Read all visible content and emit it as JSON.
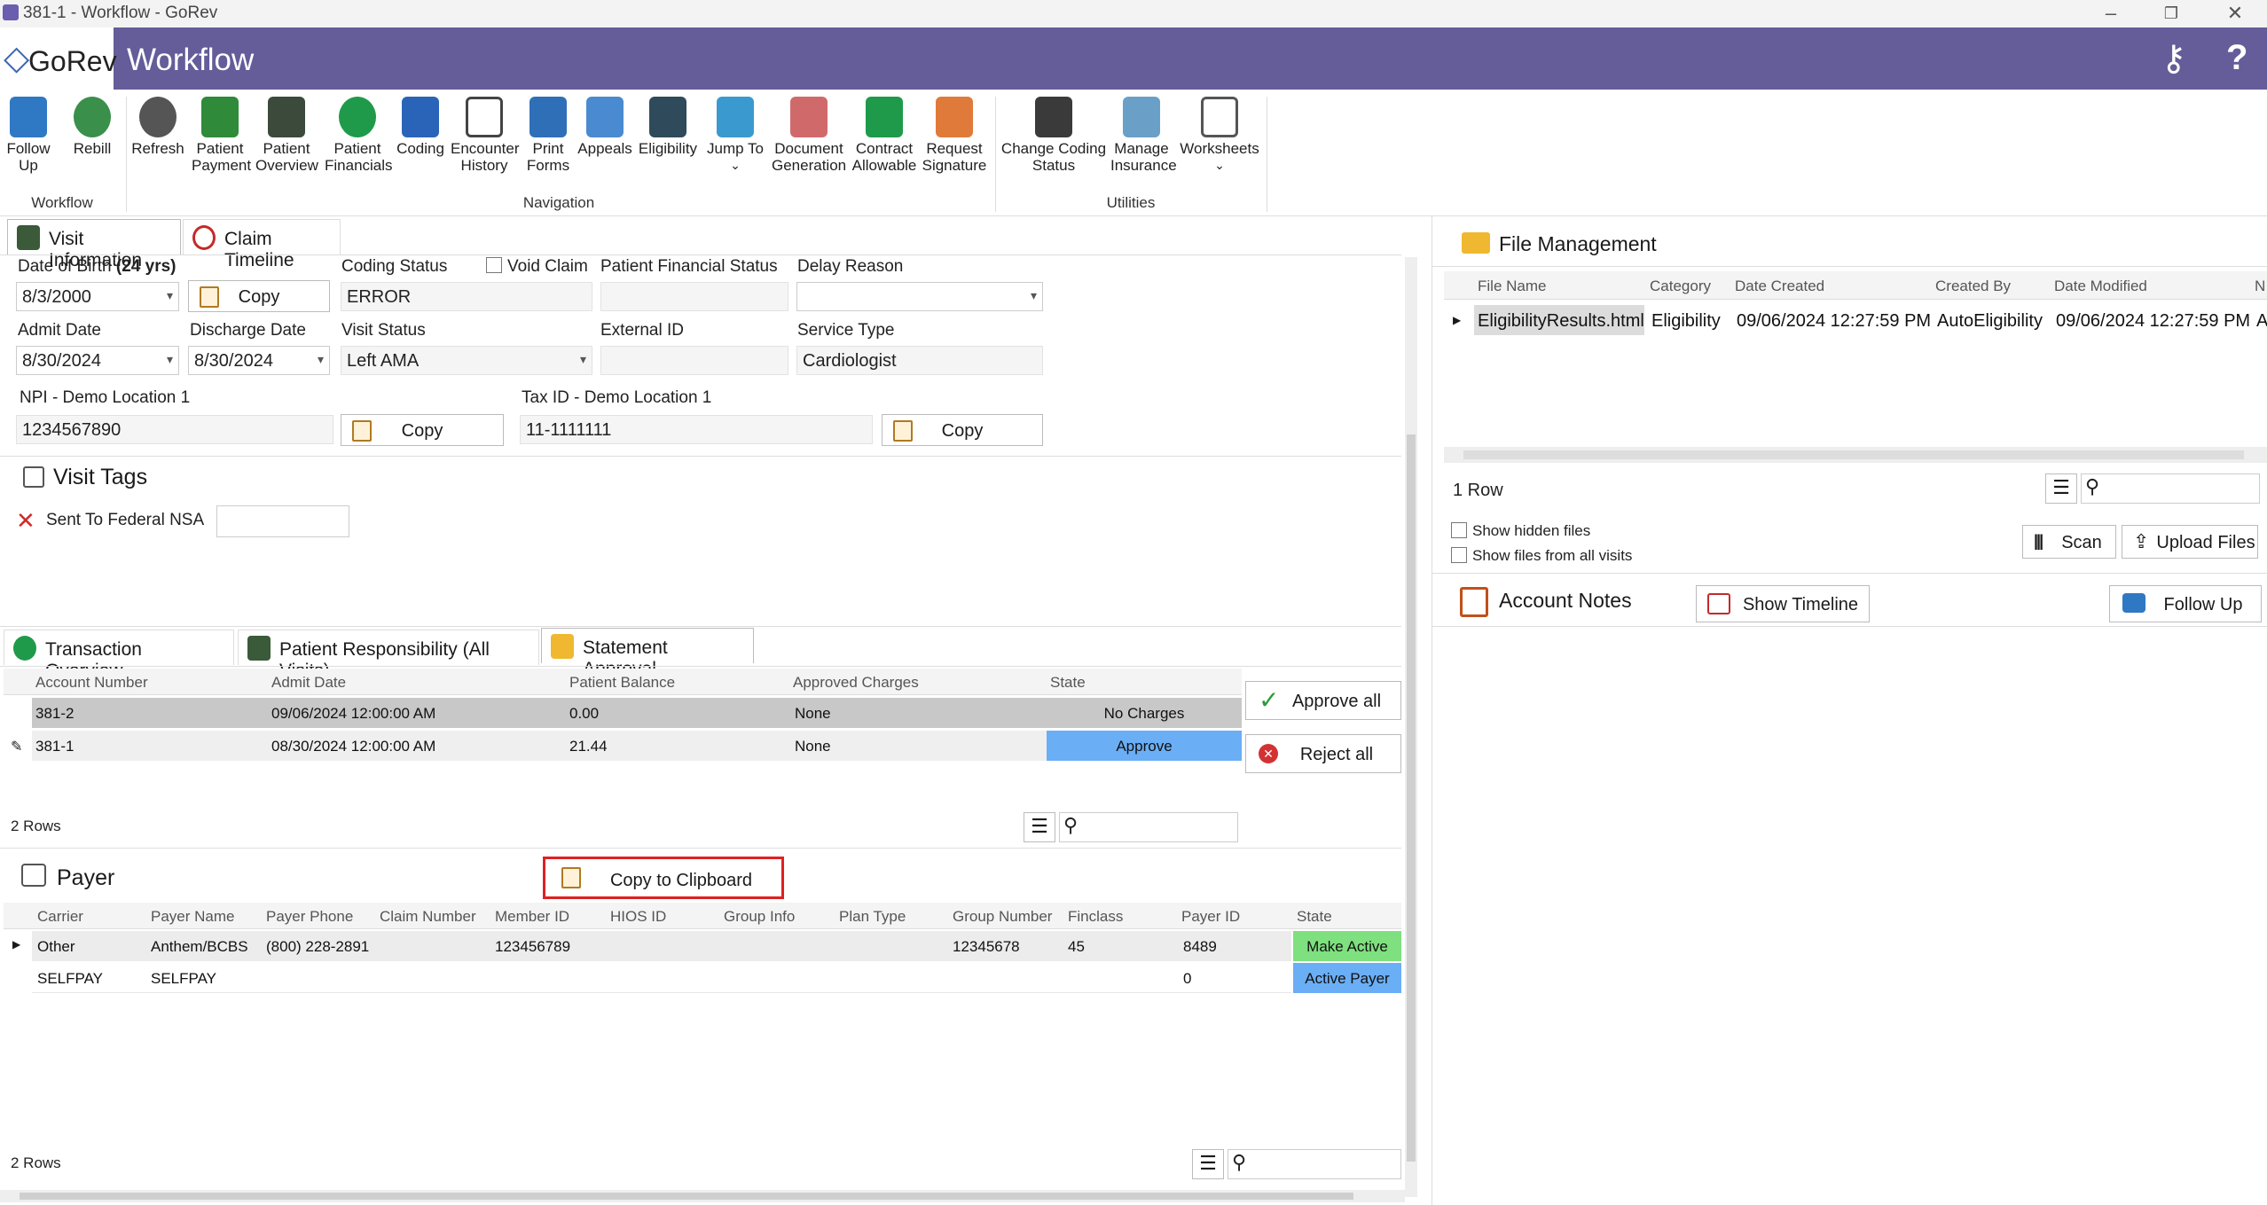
{
  "window": {
    "title": "381-1 - Workflow - GoRev"
  },
  "header": {
    "logo_text": "GoRev",
    "title": "Workflow"
  },
  "ribbon": {
    "items": [
      {
        "label": "Follow\nUp",
        "icon": "follow-up-icon"
      },
      {
        "label": "Rebill",
        "icon": "rebill-icon"
      },
      {
        "label": "Refresh",
        "icon": "refresh-icon"
      },
      {
        "label": "Patient\nPayment",
        "icon": "patient-payment-icon"
      },
      {
        "label": "Patient\nOverview",
        "icon": "patient-overview-icon"
      },
      {
        "label": "Patient\nFinancials",
        "icon": "dollar-icon"
      },
      {
        "label": "Coding",
        "icon": "coding-icon"
      },
      {
        "label": "Encounter\nHistory",
        "icon": "calendar-icon"
      },
      {
        "label": "Print\nForms",
        "icon": "printer-icon"
      },
      {
        "label": "Appeals",
        "icon": "appeals-icon"
      },
      {
        "label": "Eligibility",
        "icon": "eligibility-icon"
      },
      {
        "label": "Jump To",
        "icon": "jump-arrow-icon"
      },
      {
        "label": "Document\nGeneration",
        "icon": "document-generation-icon"
      },
      {
        "label": "Contract\nAllowable",
        "icon": "contract-icon"
      },
      {
        "label": "Request\nSignature",
        "icon": "signature-icon"
      },
      {
        "label": "Change Coding\nStatus",
        "icon": "change-status-icon"
      },
      {
        "label": "Manage\nInsurance",
        "icon": "insurance-icon"
      },
      {
        "label": "Worksheets",
        "icon": "worksheets-icon"
      }
    ],
    "groups": [
      "Workflow",
      "Navigation",
      "Utilities"
    ]
  },
  "visit_tabs": [
    "Visit Information",
    "Claim Timeline"
  ],
  "visit": {
    "dob_label": "Date of Birth",
    "dob_age": "(24 yrs)",
    "dob": "8/3/2000",
    "copy": "Copy",
    "coding_status_label": "Coding Status",
    "coding_status": "ERROR",
    "void_claim": "Void Claim",
    "pfs_label": "Patient Financial Status",
    "delay_label": "Delay Reason",
    "admit_label": "Admit Date",
    "admit": "8/30/2024",
    "discharge_label": "Discharge Date",
    "discharge": "8/30/2024",
    "visit_status_label": "Visit Status",
    "visit_status": "Left AMA",
    "external_id_label": "External ID",
    "service_type_label": "Service Type",
    "service_type": "Cardiologist",
    "npi_label": "NPI - Demo Location 1",
    "npi": "1234567890",
    "tax_label": "Tax ID - Demo Location 1",
    "tax": "11-1111111"
  },
  "visit_tags": {
    "title": "Visit Tags",
    "tag": "Sent To Federal NSA"
  },
  "fin_tabs": [
    "Transaction Overview",
    "Patient Responsibility (All Visits)",
    "Statement Approval"
  ],
  "statement": {
    "columns": [
      "Account Number",
      "Admit Date",
      "Patient Balance",
      "Approved Charges",
      "State"
    ],
    "rows": [
      [
        "381-2",
        "09/06/2024 12:00:00 AM",
        "0.00",
        "None",
        "No Charges"
      ],
      [
        "381-1",
        "08/30/2024 12:00:00 AM",
        "21.44",
        "None",
        "Approve"
      ]
    ],
    "row_count": "2 Rows",
    "approve_all": "Approve all",
    "reject_all": "Reject all"
  },
  "payer": {
    "title": "Payer",
    "copy_clipboard": "Copy to Clipboard",
    "columns": [
      "Carrier",
      "Payer Name",
      "Payer Phone",
      "Claim Number",
      "Member ID",
      "HIOS ID",
      "Group Info",
      "Plan Type",
      "Group Number",
      "Finclass",
      "Payer ID",
      "State"
    ],
    "rows": [
      [
        "Other",
        "Anthem/BCBS",
        "(800) 228-2891",
        "",
        "123456789",
        "",
        "",
        "",
        "12345678",
        "45",
        "8489",
        "Make Active"
      ],
      [
        "SELFPAY",
        "SELFPAY",
        "",
        "",
        "",
        "",
        "",
        "",
        "",
        "",
        "0",
        "Active Payer"
      ]
    ],
    "row_count": "2 Rows"
  },
  "files": {
    "title": "File Management",
    "columns": [
      "File Name",
      "Category",
      "Date Created",
      "Created By",
      "Date Modified",
      "N"
    ],
    "rows": [
      [
        "EligibilityResults.html",
        "Eligibility",
        "09/06/2024 12:27:59 PM",
        "AutoEligibility",
        "09/06/2024 12:27:59 PM",
        "A"
      ]
    ],
    "row_count": "1 Row",
    "show_hidden": "Show hidden files",
    "show_all": "Show files from all visits",
    "scan": "Scan",
    "upload": "Upload Files"
  },
  "notes": {
    "title": "Account Notes",
    "show_timeline": "Show Timeline",
    "follow_up": "Follow Up"
  },
  "colors": {
    "band": "#645d99",
    "approve": "#6aaef5",
    "make_active": "#7ee07e",
    "highlight": "#e02020"
  }
}
